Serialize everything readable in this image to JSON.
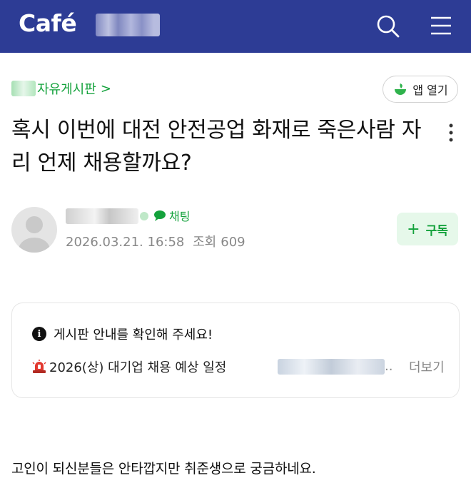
{
  "header": {
    "logo_text": "Café",
    "cafe_name_redacted": "",
    "bg_color": "#2d3c95",
    "search_icon": "search-icon",
    "menu_icon": "hamburger-menu-icon"
  },
  "board": {
    "label": "자유게시판",
    "chevron": ">"
  },
  "app_open_button": {
    "label": "앱 열기",
    "icon": "leaf-cup-icon"
  },
  "post": {
    "title": "혹시 이번에 대전 안전공업 화재로 죽은사람 자리 언제 채용할까요?",
    "more_icon": "vertical-dots-icon"
  },
  "author": {
    "avatar_icon": "default-avatar-icon",
    "chat_label": "채팅",
    "date": "2026.03.21. 16:58",
    "views_label": "조회",
    "views": "609",
    "subscribe_label": "구독"
  },
  "notice": {
    "heading": "게시판 안내를 확인해 주세요!",
    "item_text": "2026(상) 대기업 채용 예상 일정",
    "ellipsis": "..",
    "more_label": "더보기",
    "accent_color": "#14a23c"
  },
  "body": {
    "text": "고인이 되신분들은 안타깝지만 취준생으로 궁금하네요."
  }
}
